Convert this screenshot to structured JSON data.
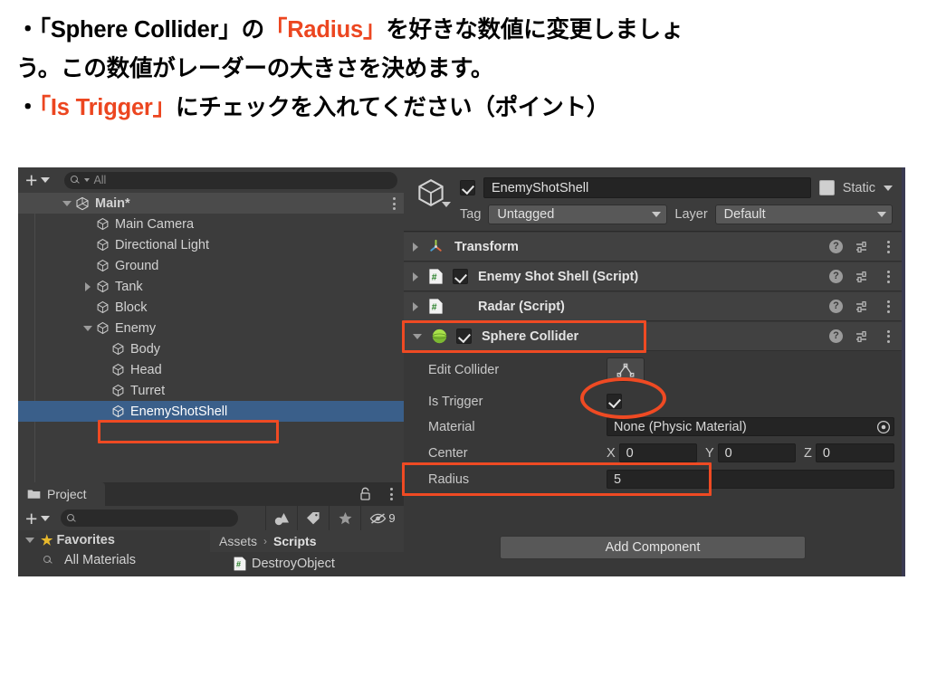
{
  "slide": {
    "line1_a": "・「Sphere Collider」の",
    "line1_b": "「Radius」",
    "line1_c": "を好きな数値に変更しましょ",
    "line2": "う。この数値がレーダーの大きさを決めます。",
    "line3_a": "・",
    "line3_b": "「Is Trigger」",
    "line3_c": "にチェックを入れてください（ポイント）",
    "accent_color": "#ec4620"
  },
  "hierarchy": {
    "search_placeholder": "All",
    "scene_name": "Main*",
    "items": [
      {
        "label": "Main Camera",
        "indent": 2,
        "expandable": false
      },
      {
        "label": "Directional Light",
        "indent": 2,
        "expandable": false
      },
      {
        "label": "Ground",
        "indent": 2,
        "expandable": false
      },
      {
        "label": "Tank",
        "indent": 2,
        "expandable": true,
        "expanded": false
      },
      {
        "label": "Block",
        "indent": 2,
        "expandable": false
      },
      {
        "label": "Enemy",
        "indent": 2,
        "expandable": true,
        "expanded": true
      },
      {
        "label": "Body",
        "indent": 3,
        "expandable": false
      },
      {
        "label": "Head",
        "indent": 3,
        "expandable": false
      },
      {
        "label": "Turret",
        "indent": 3,
        "expandable": false
      },
      {
        "label": "EnemyShotShell",
        "indent": 3,
        "expandable": false,
        "selected": true,
        "highlighted": true
      }
    ]
  },
  "project": {
    "tab_label": "Project",
    "search_value": "",
    "hidden_count": "9",
    "favorites_label": "Favorites",
    "favorites_child": "All Materials",
    "breadcrumb_root": "Assets",
    "breadcrumb_sep": "›",
    "breadcrumb_leaf": "Scripts",
    "file_item": "DestroyObject"
  },
  "inspector": {
    "object_name": "EnemyShotShell",
    "object_enabled": true,
    "static_label": "Static",
    "static_checked": false,
    "tag_label": "Tag",
    "tag_value": "Untagged",
    "layer_label": "Layer",
    "layer_value": "Default",
    "components": [
      {
        "title": "Transform",
        "icon": "transform-icon",
        "has_checkbox": false,
        "expanded": false
      },
      {
        "title": "Enemy Shot Shell (Script)",
        "icon": "script-icon",
        "has_checkbox": true,
        "checked": true,
        "expanded": false
      },
      {
        "title": "Radar (Script)",
        "icon": "script-icon",
        "has_checkbox": false,
        "expanded": false
      },
      {
        "title": "Sphere Collider",
        "icon": "sphere-collider-icon",
        "has_checkbox": true,
        "checked": true,
        "expanded": true,
        "highlighted": true
      }
    ],
    "sphere_collider": {
      "edit_collider_label": "Edit Collider",
      "is_trigger_label": "Is Trigger",
      "is_trigger_checked": true,
      "material_label": "Material",
      "material_value": "None (Physic Material)",
      "center_label": "Center",
      "center_x_axis": "X",
      "center_x": "0",
      "center_y_axis": "Y",
      "center_y": "0",
      "center_z_axis": "Z",
      "center_z": "0",
      "radius_label": "Radius",
      "radius_value": "5"
    },
    "add_component_label": "Add Component"
  }
}
